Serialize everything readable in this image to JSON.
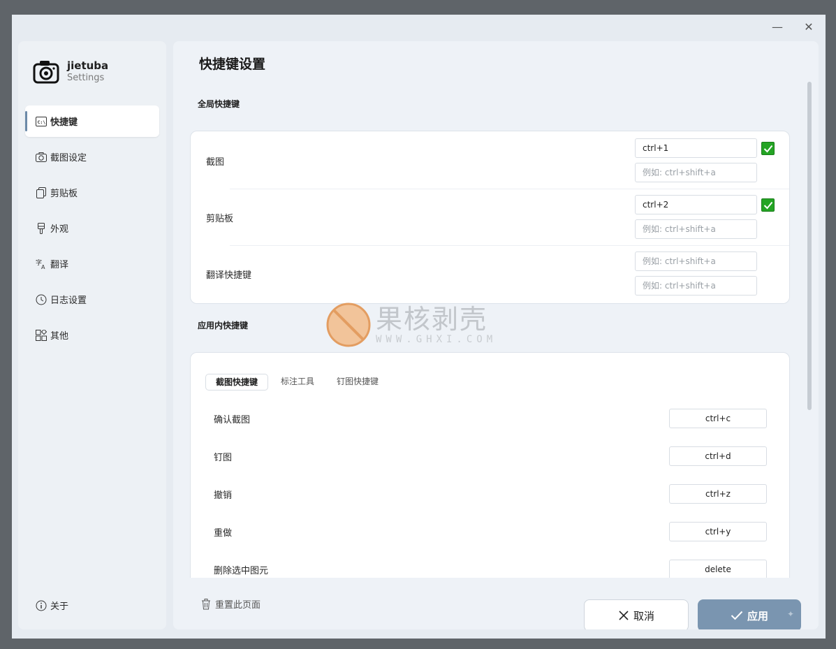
{
  "window": {
    "minimize": "—",
    "close": "✕"
  },
  "app": {
    "name": "jietuba",
    "subtitle": "Settings"
  },
  "sidebar": {
    "items": [
      {
        "label": "快捷键",
        "icon": "terminal-icon"
      },
      {
        "label": "截图设定",
        "icon": "camera-icon"
      },
      {
        "label": "剪贴板",
        "icon": "clipboard-icon"
      },
      {
        "label": "外观",
        "icon": "paintbrush-icon"
      },
      {
        "label": "翻译",
        "icon": "translate-icon"
      },
      {
        "label": "日志设置",
        "icon": "history-icon"
      },
      {
        "label": "其他",
        "icon": "apps-icon"
      }
    ],
    "about": "关于"
  },
  "main": {
    "title": "快捷键设置",
    "global_section": "全局快捷键",
    "global_rows": [
      {
        "label": "截图",
        "value": "ctrl+1",
        "placeholder": "例如: ctrl+shift+a"
      },
      {
        "label": "剪贴板",
        "value": "ctrl+2",
        "placeholder": "例如: ctrl+shift+a"
      },
      {
        "label": "翻译快捷键",
        "placeholder1": "例如: ctrl+shift+a",
        "placeholder2": "例如: ctrl+shift+a"
      }
    ],
    "app_section": "应用内快捷键",
    "tabs": [
      "截图快捷键",
      "标注工具",
      "钉图快捷键"
    ],
    "app_rows": [
      {
        "label": "确认截图",
        "key": "ctrl+c"
      },
      {
        "label": "钉图",
        "key": "ctrl+d"
      },
      {
        "label": "撤销",
        "key": "ctrl+z"
      },
      {
        "label": "重做",
        "key": "ctrl+y"
      },
      {
        "label": "删除选中图元",
        "key": "delete"
      }
    ]
  },
  "footer": {
    "reset": "重置此页面",
    "cancel": "取消",
    "apply": "应用"
  },
  "watermark": {
    "cn": "果核剥壳",
    "en": "WWW.GHXI.COM"
  },
  "colors": {
    "accent": "#7a95b0",
    "check": "#24a424",
    "watermark_orange": "#f2c49a"
  }
}
